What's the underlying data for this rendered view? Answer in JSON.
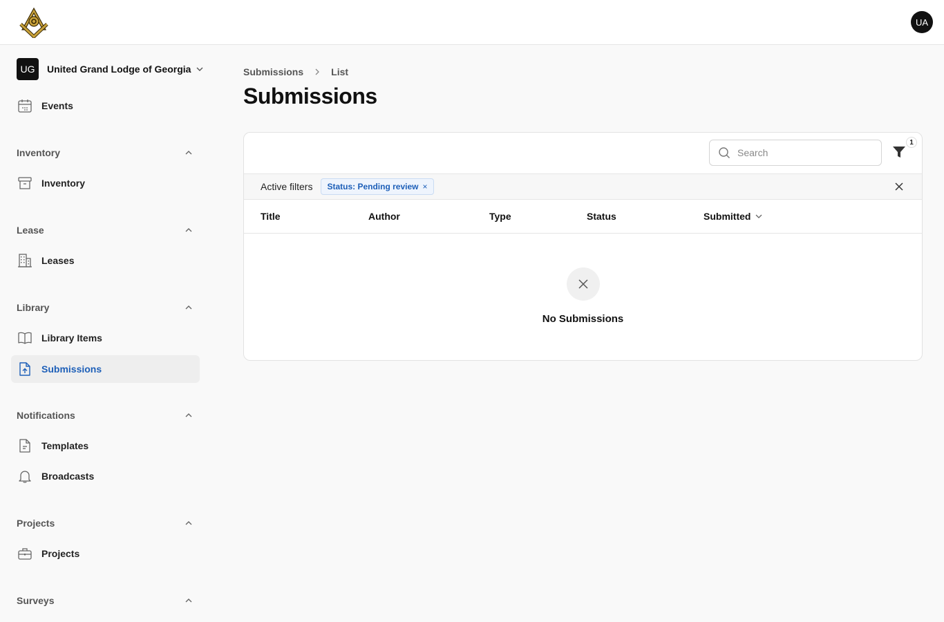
{
  "topbar": {
    "user_initials": "UA"
  },
  "sidebar": {
    "org": {
      "initials": "UG",
      "name": "United Grand Lodge of Georgia"
    },
    "events_label": "Events",
    "sections": {
      "inventory": {
        "title": "Inventory",
        "items": [
          "Inventory"
        ]
      },
      "lease": {
        "title": "Lease",
        "items": [
          "Leases"
        ]
      },
      "library": {
        "title": "Library",
        "items": [
          "Library Items",
          "Submissions"
        ]
      },
      "notifications": {
        "title": "Notifications",
        "items": [
          "Templates",
          "Broadcasts"
        ]
      },
      "projects": {
        "title": "Projects",
        "items": [
          "Projects"
        ]
      },
      "surveys": {
        "title": "Surveys"
      }
    },
    "active_item": "Submissions"
  },
  "breadcrumb": [
    "Submissions",
    "List"
  ],
  "page_title": "Submissions",
  "toolbar": {
    "search_placeholder": "Search",
    "filter_count": "1"
  },
  "filters": {
    "label": "Active filters",
    "chips": [
      "Status: Pending review"
    ],
    "chip_remove": "×"
  },
  "table": {
    "columns": [
      "Title",
      "Author",
      "Type",
      "Status",
      "Submitted"
    ],
    "sorted_column": "Submitted",
    "sort_direction": "descending"
  },
  "empty_state": {
    "text": "No Submissions"
  },
  "colors": {
    "accent": "#1d5fb8",
    "dark": "#111111"
  }
}
